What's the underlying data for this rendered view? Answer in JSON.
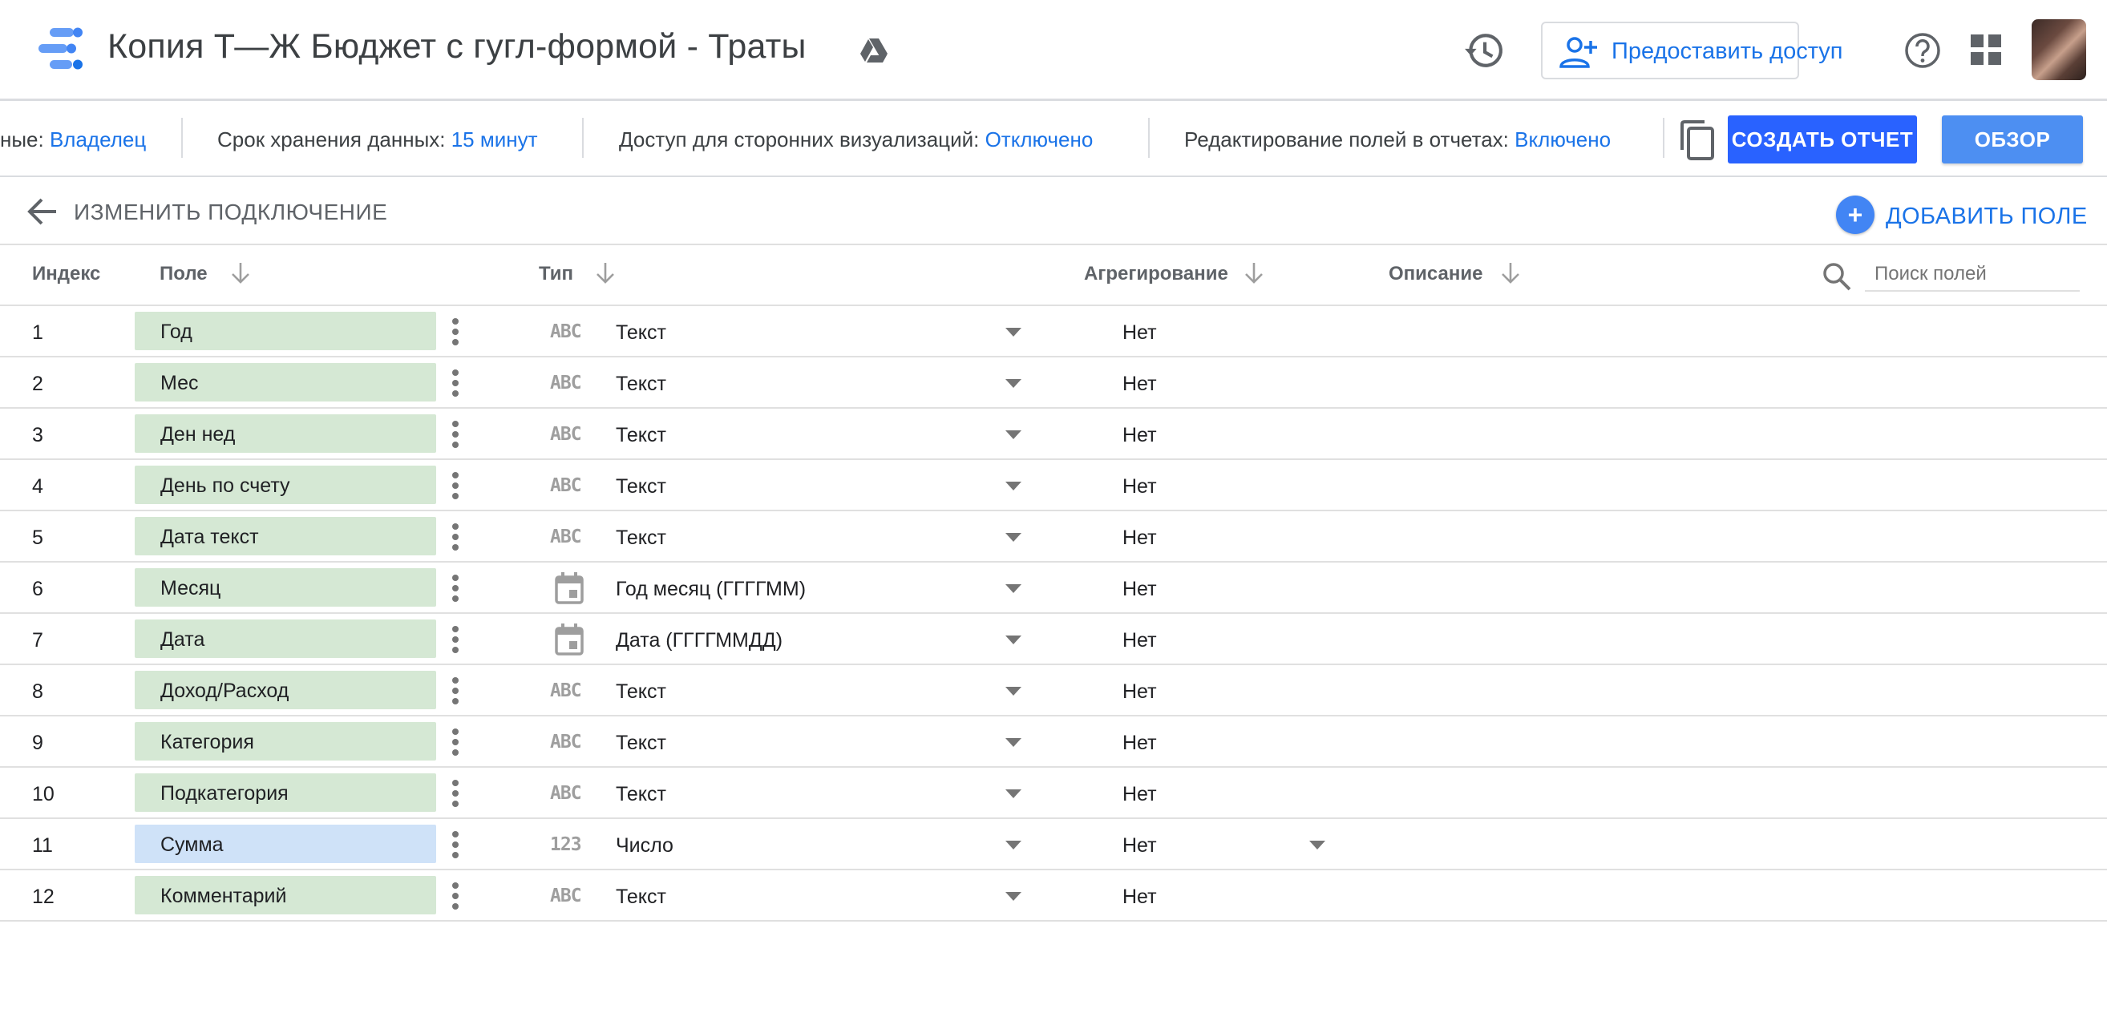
{
  "app": {
    "title": "Копия Т—Ж Бюджет с гугл-формой - Траты",
    "share_label": "Предоставить доступ"
  },
  "infobar": {
    "owner_label": "ные: ",
    "owner_value": "Владелец",
    "retention_label": "Срок хранения данных: ",
    "retention_value": "15 минут",
    "viz_label": "Доступ для сторонних визуализаций: ",
    "viz_value": "Отключено",
    "edit_label": "Редактирование полей в отчетах: ",
    "edit_value": "Включено",
    "create_report": "СОЗДАТЬ ОТЧЕТ",
    "review": "ОБЗОР"
  },
  "subheader": {
    "edit_connection": "ИЗМЕНИТЬ ПОДКЛЮЧЕНИЕ",
    "add_field": "ДОБАВИТЬ ПОЛЕ"
  },
  "table": {
    "columns": {
      "index": "Индекс",
      "field": "Поле",
      "type": "Тип",
      "aggregation": "Агрегирование",
      "description": "Описание"
    },
    "search_placeholder": "Поиск полей",
    "rows": [
      {
        "index": "1",
        "field": "Год",
        "kind": "dimension",
        "type_icon": "abc-icon",
        "type": "Текст",
        "agg": "Нет"
      },
      {
        "index": "2",
        "field": "Мес",
        "kind": "dimension",
        "type_icon": "abc-icon",
        "type": "Текст",
        "agg": "Нет"
      },
      {
        "index": "3",
        "field": "Ден нед",
        "kind": "dimension",
        "type_icon": "abc-icon",
        "type": "Текст",
        "agg": "Нет"
      },
      {
        "index": "4",
        "field": "День по счету",
        "kind": "dimension",
        "type_icon": "abc-icon",
        "type": "Текст",
        "agg": "Нет"
      },
      {
        "index": "5",
        "field": "Дата текст",
        "kind": "dimension",
        "type_icon": "abc-icon",
        "type": "Текст",
        "agg": "Нет"
      },
      {
        "index": "6",
        "field": "Месяц",
        "kind": "dimension",
        "type_icon": "calendar-icon",
        "type": "Год месяц (ГГГГММ)",
        "agg": "Нет"
      },
      {
        "index": "7",
        "field": "Дата",
        "kind": "dimension",
        "type_icon": "calendar-icon",
        "type": "Дата (ГГГГММДД)",
        "agg": "Нет"
      },
      {
        "index": "8",
        "field": "Доход/Расход",
        "kind": "dimension",
        "type_icon": "abc-icon",
        "type": "Текст",
        "agg": "Нет"
      },
      {
        "index": "9",
        "field": "Категория",
        "kind": "dimension",
        "type_icon": "abc-icon",
        "type": "Текст",
        "agg": "Нет"
      },
      {
        "index": "10",
        "field": "Подкатегория",
        "kind": "dimension",
        "type_icon": "abc-icon",
        "type": "Текст",
        "agg": "Нет"
      },
      {
        "index": "11",
        "field": "Сумма",
        "kind": "metric",
        "type_icon": "number-icon",
        "type": "Число",
        "agg": "Нет"
      },
      {
        "index": "12",
        "field": "Комментарий",
        "kind": "dimension",
        "type_icon": "abc-icon",
        "type": "Текст",
        "agg": "Нет"
      }
    ]
  },
  "colors": {
    "accent": "#1a73e8",
    "create_button": "#2962ff",
    "review_button": "#4d8ff2",
    "dimension_chip": "#d5e8d4",
    "metric_chip": "#cfe2f8"
  },
  "icons": {
    "abc_glyph": "ABC",
    "number_glyph": "123"
  }
}
